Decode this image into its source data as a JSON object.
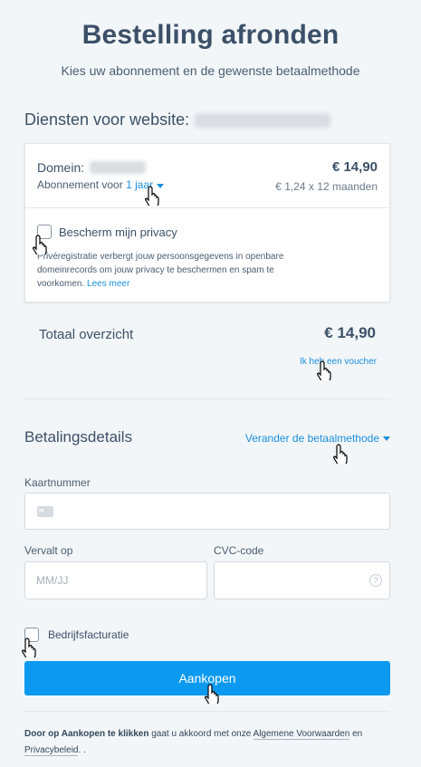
{
  "header": {
    "title": "Bestelling afronden",
    "subtitle": "Kies uw abonnement en de gewenste betaalmethode"
  },
  "services": {
    "heading": "Diensten voor website:",
    "website_name": "http://online.nl/..."
  },
  "domain_card": {
    "domain_label": "Domein:",
    "domain_value": "example.com",
    "price": "€ 14,90",
    "subscription_label": "Abonnement voor",
    "subscription_value": "1 jaar",
    "price_breakdown": "€ 1,24 x 12 maanden",
    "privacy_label": "Bescherm mijn privacy",
    "privacy_checked": false,
    "privacy_desc": "Privéregistratie verbergt jouw persoonsgegevens in openbare domeinrecords om jouw privacy te beschermen en spam te voorkomen.",
    "read_more": "Lees meer"
  },
  "total": {
    "label": "Totaal overzicht",
    "price": "€ 14,90",
    "voucher": "Ik heb een voucher"
  },
  "payment": {
    "heading": "Betalingsdetails",
    "change_method": "Verander de betaalmethode",
    "card_number_label": "Kaartnummer",
    "card_number_value": "",
    "expiry_label": "Vervalt op",
    "expiry_placeholder": "MM/JJ",
    "cvc_label": "CVC-code",
    "cvc_value": "",
    "help_glyph": "?",
    "business_label": "Bedrijfsfacturatie",
    "business_checked": false,
    "buy_button": "Aankopen"
  },
  "terms": {
    "bold": "Door op Aankopen te klikken",
    "middle": "gaat u akkoord met onze",
    "terms_link": "Algemene Voorwaarden",
    "and": "en",
    "privacy_link": "Privacybeleid",
    "end": ". ."
  },
  "colors": {
    "accent": "#0c9af0",
    "link": "#1a8fe0",
    "text": "#3b5068",
    "background": "#f3f6f8"
  },
  "icons": [
    "credit-card-icon",
    "help-icon",
    "caret-down-icon",
    "hand-cursor-icon"
  ]
}
